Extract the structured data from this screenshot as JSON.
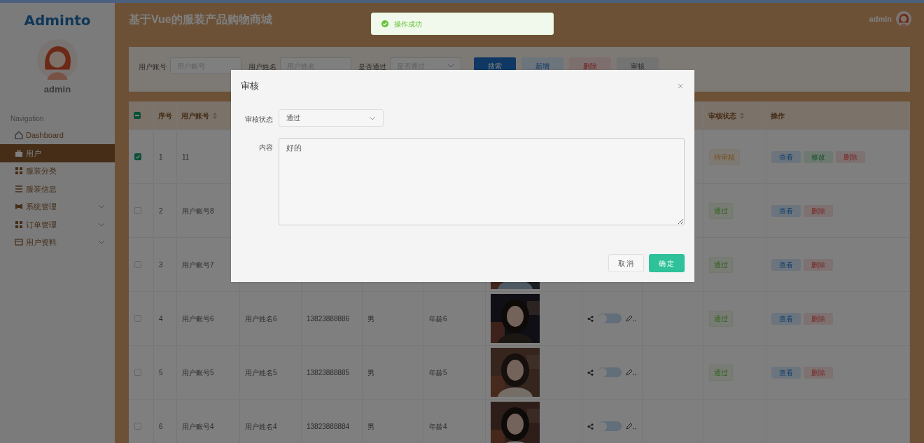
{
  "sidebar": {
    "logo": "Adminto",
    "user": "admin",
    "nav_heading": "Navigation",
    "items": [
      {
        "label": "Dashboard",
        "selected": false,
        "expandable": false
      },
      {
        "label": "用户",
        "selected": true,
        "expandable": false
      },
      {
        "label": "服装分类",
        "selected": false,
        "expandable": false
      },
      {
        "label": "服装信息",
        "selected": false,
        "expandable": false
      },
      {
        "label": "系统管理",
        "selected": false,
        "expandable": true
      },
      {
        "label": "订单管理",
        "selected": false,
        "expandable": true
      },
      {
        "label": "用户资料",
        "selected": false,
        "expandable": true
      }
    ]
  },
  "header": {
    "title": "基于Vue的服装产品购物商城",
    "user": "admin"
  },
  "toast": {
    "text": "操作成功"
  },
  "search": {
    "fields": [
      {
        "label": "用户账号",
        "placeholder": "用户账号",
        "kind": "input"
      },
      {
        "label": "用户姓名",
        "placeholder": "用户姓名",
        "kind": "input"
      },
      {
        "label": "是否通过",
        "placeholder": "是否通过",
        "kind": "select"
      }
    ],
    "buttons": [
      {
        "label": "搜索",
        "kind": "primary"
      },
      {
        "label": "新增",
        "kind": "info"
      },
      {
        "label": "删除",
        "kind": "danger"
      },
      {
        "label": "审核",
        "kind": "plain"
      }
    ]
  },
  "table": {
    "select_all_partial": true,
    "columns": [
      {
        "kind": "index",
        "label": "序号",
        "sortable": false
      },
      {
        "kind": "account",
        "label": "用户账号",
        "sortable": true
      },
      {
        "kind": "status",
        "label": "审核状态",
        "sortable": true
      },
      {
        "kind": "actions",
        "label": "操作",
        "sortable": false
      }
    ],
    "rows": [
      {
        "checked": true,
        "index": "1",
        "account": "11",
        "status": {
          "label": "待审核",
          "kind": "pending"
        },
        "actions": [
          {
            "label": "查看",
            "kind": "view"
          },
          {
            "label": "修改",
            "kind": "edit"
          },
          {
            "label": "删除",
            "kind": "delete"
          }
        ]
      },
      {
        "checked": false,
        "index": "2",
        "account": "用户账号8",
        "status": {
          "label": "通过",
          "kind": "passed"
        },
        "actions": [
          {
            "label": "查看",
            "kind": "view"
          },
          {
            "label": "删除",
            "kind": "delete"
          }
        ]
      },
      {
        "checked": false,
        "index": "3",
        "account": "用户账号7",
        "photo": {
          "kind": "picture"
        },
        "status": {
          "label": "通过",
          "kind": "passed"
        },
        "actions": [
          {
            "label": "查看",
            "kind": "view"
          },
          {
            "label": "删除",
            "kind": "delete"
          }
        ]
      },
      {
        "checked": false,
        "index": "4",
        "account": "用户账号6",
        "name": "用户姓名6",
        "phone": "13823888886",
        "gender": "男",
        "age": "年龄6",
        "photo": {
          "kind": "picture"
        },
        "enabled": false,
        "status": {
          "label": "通过",
          "kind": "passed"
        },
        "actions": [
          {
            "label": "查看",
            "kind": "view"
          },
          {
            "label": "删除",
            "kind": "delete"
          }
        ]
      },
      {
        "checked": false,
        "index": "5",
        "account": "用户账号5",
        "name": "用户姓名5",
        "phone": "13823888885",
        "gender": "男",
        "age": "年龄5",
        "photo": {
          "kind": "picture"
        },
        "enabled": false,
        "status": {
          "label": "通过",
          "kind": "passed"
        },
        "actions": [
          {
            "label": "查看",
            "kind": "view"
          },
          {
            "label": "删除",
            "kind": "delete"
          }
        ]
      },
      {
        "checked": false,
        "index": "6",
        "account": "用户账号4",
        "name": "用户姓名4",
        "phone": "13823888884",
        "gender": "男",
        "age": "年龄4",
        "photo": {
          "kind": "picture"
        },
        "enabled": false
      }
    ]
  },
  "dialog": {
    "title": "审核",
    "fields": [
      {
        "label": "审核状态",
        "kind": "select",
        "value": "通过"
      },
      {
        "label": "内容",
        "kind": "textarea",
        "value": "好的"
      }
    ],
    "buttons": [
      {
        "label": "取消",
        "kind": "plain"
      },
      {
        "label": "确定",
        "kind": "primary"
      }
    ]
  }
}
